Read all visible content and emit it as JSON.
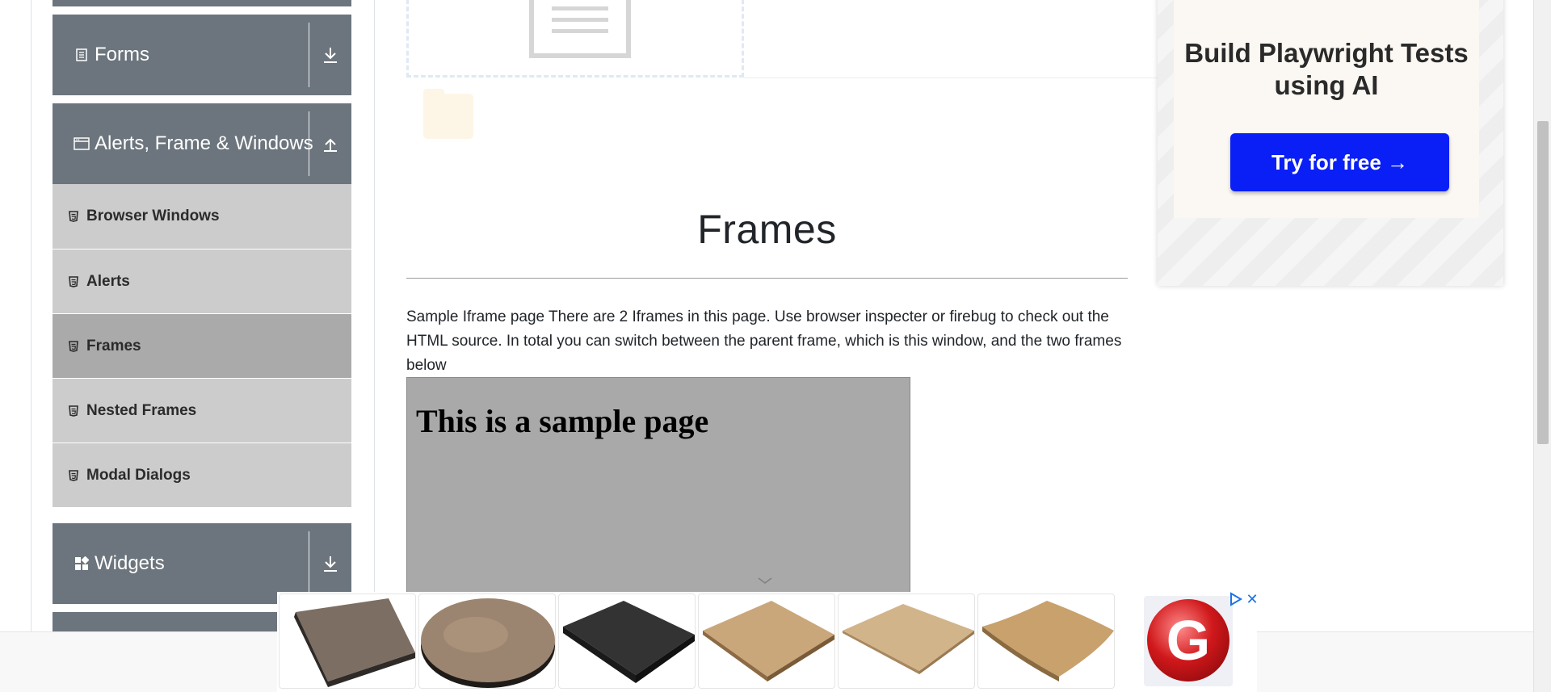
{
  "sidebar": {
    "groups": [
      {
        "title": "Forms",
        "icon": "document-icon",
        "expanded": false
      },
      {
        "title": "Alerts, Frame & Windows",
        "icon": "window-icon",
        "expanded": true,
        "items": [
          {
            "label": "Browser Windows",
            "active": false
          },
          {
            "label": "Alerts",
            "active": false
          },
          {
            "label": "Frames",
            "active": true
          },
          {
            "label": "Nested Frames",
            "active": false
          },
          {
            "label": "Modal Dialogs",
            "active": false
          }
        ]
      },
      {
        "title": "Widgets",
        "icon": "widgets-icon",
        "expanded": false
      }
    ]
  },
  "main": {
    "heading": "Frames",
    "description": "Sample Iframe page There are 2 Iframes in this page. Use browser inspecter or firebug to check out the HTML source. In total you can switch between the parent frame, which is this window, and the two frames below",
    "iframe_heading": "This is a sample page"
  },
  "ad_right": {
    "title": "Build Playwright Tests using AI",
    "button_label": "Try for free →",
    "button_color": "#0a1ff5"
  },
  "bottom_ad": {
    "logo_letter": "G",
    "close_label": "✕"
  },
  "colors": {
    "group_header": "#6c757d",
    "item_bg": "#cccccc",
    "item_active_bg": "#aaaaaa",
    "iframe_bg": "#a9a9a9"
  }
}
